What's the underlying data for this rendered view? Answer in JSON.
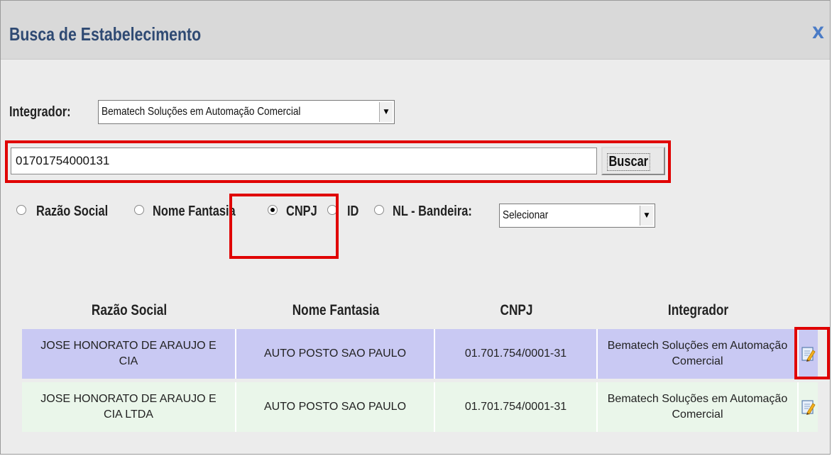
{
  "dialog": {
    "title": "Busca de Estabelecimento",
    "close_label": "X"
  },
  "integrador": {
    "label": "Integrador:",
    "selected": "Bematech Soluções em Automação Comercial"
  },
  "search": {
    "value": "01701754000131",
    "button_label": "Buscar"
  },
  "filters": {
    "options": [
      "Razão Social",
      "Nome Fantasia",
      "CNPJ",
      "ID"
    ],
    "selected": "CNPJ",
    "bandeira_label": "NL - Bandeira:",
    "bandeira_selected": "Selecionar"
  },
  "table": {
    "headers": [
      "Razão Social",
      "Nome Fantasia",
      "CNPJ",
      "Integrador"
    ],
    "rows": [
      {
        "razao_social": "JOSE HONORATO DE ARAUJO E CIA",
        "nome_fantasia": "AUTO POSTO SAO PAULO",
        "cnpj": "01.701.754/0001-31",
        "integrador": "Bematech Soluções em Automação Comercial",
        "action_icon": "edit-icon"
      },
      {
        "razao_social": "JOSE HONORATO DE ARAUJO E CIA LTDA",
        "nome_fantasia": "AUTO POSTO SAO PAULO",
        "cnpj": "01.701.754/0001-31",
        "integrador": "Bematech Soluções em Automação Comercial",
        "action_icon": "edit-icon"
      }
    ]
  },
  "colors": {
    "highlight_box": "#e00000",
    "title_text": "#2f4a73",
    "row_selected_bg": "#c9c9f3",
    "row_alt_bg": "#eaf6ea"
  }
}
